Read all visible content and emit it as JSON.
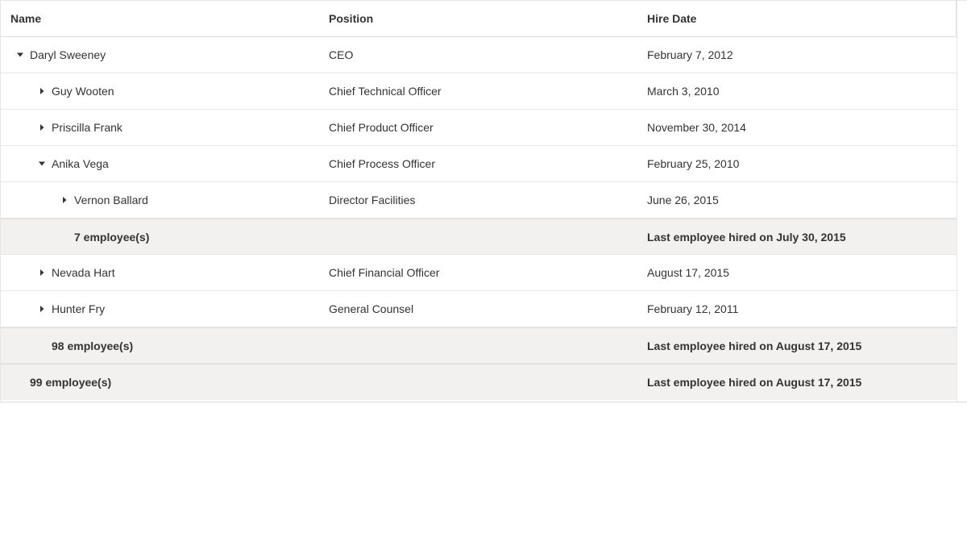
{
  "columns": {
    "name": "Name",
    "position": "Position",
    "hire_date": "Hire Date"
  },
  "rows": [
    {
      "name": "Daryl Sweeney",
      "position": "CEO",
      "hire_date": "February 7, 2012",
      "expanded": true,
      "level": 0,
      "toggle_icon": "caret-down-icon"
    },
    {
      "name": "Guy Wooten",
      "position": "Chief Technical Officer",
      "hire_date": "March 3, 2010",
      "expanded": false,
      "level": 1,
      "toggle_icon": "caret-right-icon"
    },
    {
      "name": "Priscilla Frank",
      "position": "Chief Product Officer",
      "hire_date": "November 30, 2014",
      "expanded": false,
      "level": 1,
      "toggle_icon": "caret-right-icon"
    },
    {
      "name": "Anika Vega",
      "position": "Chief Process Officer",
      "hire_date": "February 25, 2010",
      "expanded": true,
      "level": 1,
      "toggle_icon": "caret-down-icon"
    },
    {
      "name": "Vernon Ballard",
      "position": "Director Facilities",
      "hire_date": "June 26, 2015",
      "expanded": false,
      "level": 2,
      "toggle_icon": "caret-right-icon"
    },
    {
      "name": "Nevada Hart",
      "position": "Chief Financial Officer",
      "hire_date": "August 17, 2015",
      "expanded": false,
      "level": 1,
      "toggle_icon": "caret-right-icon"
    },
    {
      "name": "Hunter Fry",
      "position": "General Counsel",
      "hire_date": "February 12, 2011",
      "expanded": false,
      "level": 1,
      "toggle_icon": "caret-right-icon"
    }
  ],
  "footers": {
    "anika_vega": {
      "count": "7 employee(s)",
      "last_hired": "Last employee hired on July 30, 2015"
    },
    "daryl_sweeney": {
      "count": "98 employee(s)",
      "last_hired": "Last employee hired on August 17, 2015"
    },
    "total": {
      "count": "99 employee(s)",
      "last_hired": "Last employee hired on August 17, 2015"
    }
  }
}
